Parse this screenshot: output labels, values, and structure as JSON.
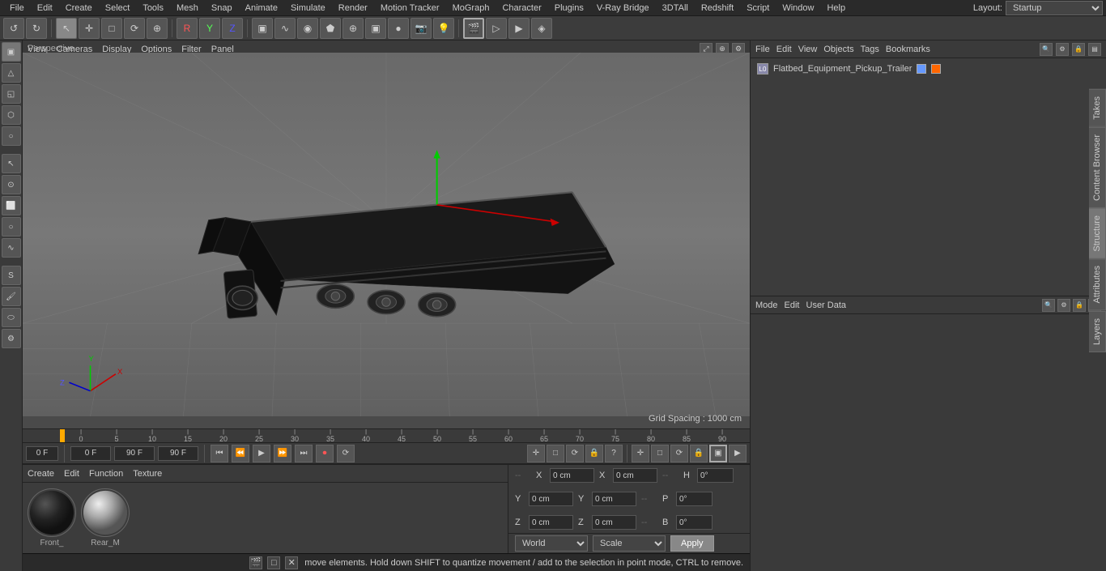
{
  "menubar": {
    "items": [
      "File",
      "Edit",
      "Create",
      "Select",
      "Tools",
      "Mesh",
      "Snap",
      "Animate",
      "Simulate",
      "Render",
      "Motion Tracker",
      "MoGraph",
      "Character",
      "Plugins",
      "V-Ray Bridge",
      "3DTAll",
      "Redshift",
      "Script",
      "Window",
      "Help"
    ],
    "layout_label": "Layout:",
    "layout_value": "Startup"
  },
  "toolbar": {
    "undo_label": "↺",
    "redo_label": "↻",
    "tools": [
      "↖",
      "✛",
      "□",
      "⟳",
      "⊕",
      "R",
      "Y",
      "Z",
      "▣",
      "▷",
      "⌂",
      "·",
      "◉",
      "⬟",
      "⊕",
      "▣",
      "●",
      "◈",
      "📷",
      "💡"
    ]
  },
  "viewport": {
    "perspective_label": "Perspective",
    "menus": [
      "View",
      "Cameras",
      "Display",
      "Options",
      "Filter",
      "Panel"
    ],
    "grid_spacing": "Grid Spacing : 1000 cm"
  },
  "timeline": {
    "ticks": [
      "0",
      "5",
      "10",
      "15",
      "20",
      "25",
      "30",
      "35",
      "40",
      "45",
      "50",
      "55",
      "60",
      "65",
      "70",
      "75",
      "80",
      "85",
      "90"
    ],
    "start_frame": "0 F",
    "current_frame_left": "0 F",
    "frame_start": "0 F",
    "frame_end": "90 F",
    "frame_current": "90 F"
  },
  "playback": {
    "frame_start": "0 F",
    "frame_end": "90 F",
    "frame_current": "90 F",
    "buttons": [
      "⏮",
      "⏪",
      "▶",
      "⏩",
      "⏭",
      "⟳"
    ]
  },
  "playback_extra": {
    "buttons": [
      "✛",
      "□",
      "⟳",
      "🔒",
      "?",
      "✛",
      "□",
      "⟳",
      "🔒",
      "▣",
      "▶"
    ]
  },
  "materials": {
    "header_menus": [
      "Create",
      "Edit",
      "Function",
      "Texture"
    ],
    "items": [
      {
        "name": "Front_",
        "sphere_type": "dark"
      },
      {
        "name": "Rear_M",
        "sphere_type": "highlight"
      }
    ]
  },
  "coordinates": {
    "x_label": "X",
    "y_label": "Y",
    "z_label": "Z",
    "x_val": "0 cm",
    "y_val": "0 cm",
    "z_val": "0 cm",
    "x_val2": "0 cm",
    "y_val2": "0 cm",
    "z_val2": "0 cm",
    "h_label": "H",
    "p_label": "P",
    "b_label": "B",
    "h_val": "0°",
    "p_val": "0°",
    "b_val": "0°",
    "sep1": "--",
    "sep2": "--",
    "sep3": "--",
    "world_label": "World",
    "scale_label": "Scale",
    "apply_label": "Apply"
  },
  "objects_panel": {
    "menus": [
      "File",
      "Edit",
      "View",
      "Objects",
      "Tags",
      "Bookmarks"
    ],
    "object_name": "Flatbed_Equipment_Pickup_Trailer"
  },
  "attributes_panel": {
    "menus": [
      "Mode",
      "Edit",
      "User Data"
    ]
  },
  "status": {
    "text": "move elements. Hold down SHIFT to quantize movement / add to the selection in point mode, CTRL to remove.",
    "icons": [
      "🎬",
      "□",
      "✕"
    ]
  },
  "right_tabs": [
    "Takes",
    "Content Browser",
    "Structure",
    "Attributes",
    "Layers"
  ]
}
